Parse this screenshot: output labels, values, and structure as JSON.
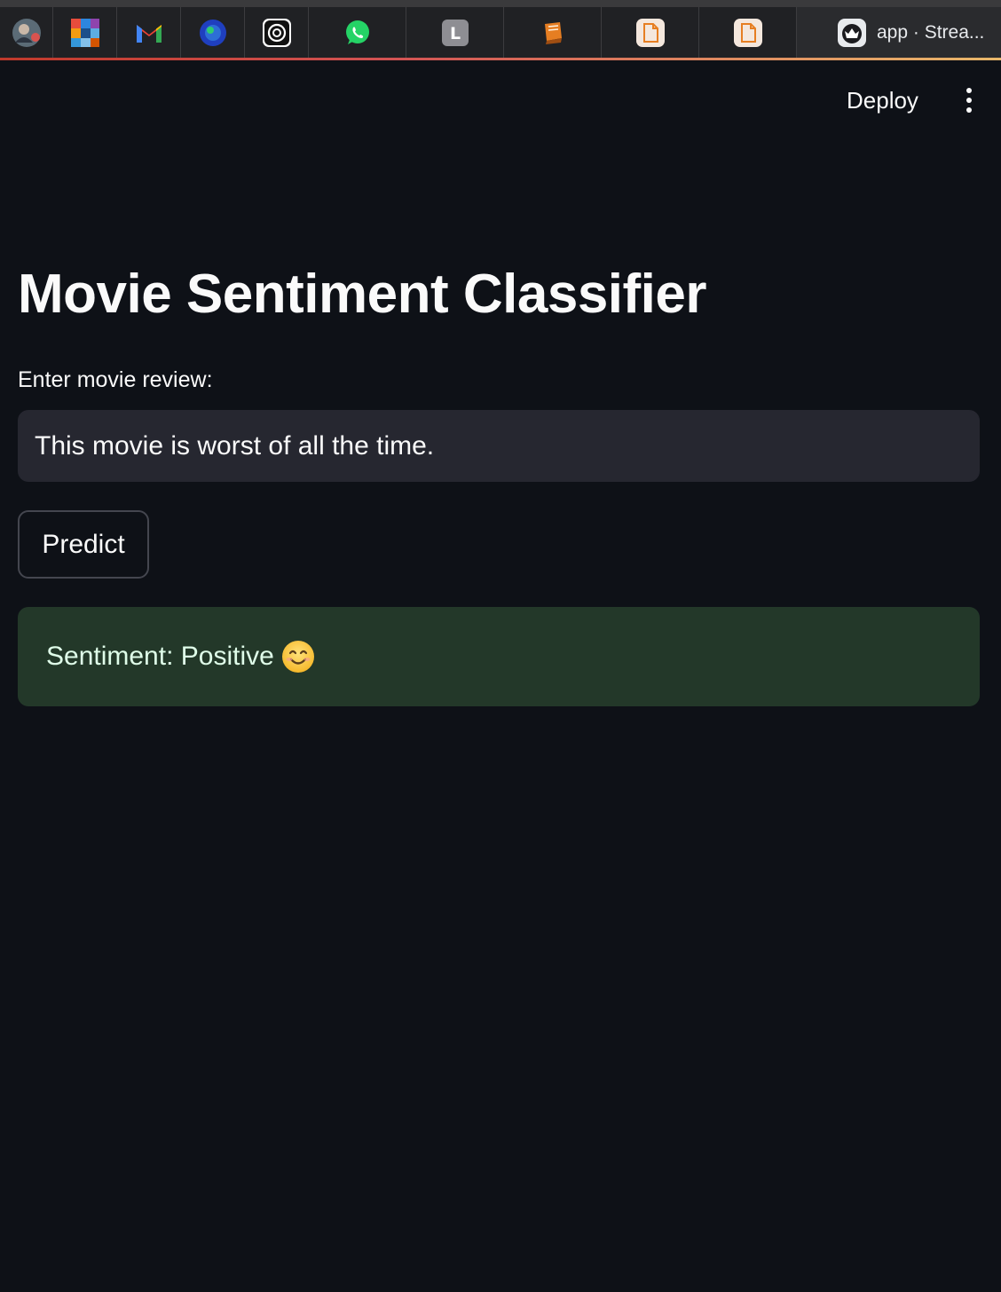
{
  "browser": {
    "active_tab": {
      "title": "app · Strea..."
    },
    "pinned_tabs": [
      {
        "icon": "profile-avatar-icon"
      },
      {
        "icon": "colorful-grid-icon"
      },
      {
        "icon": "gmail-icon"
      },
      {
        "icon": "blue-orb-icon"
      },
      {
        "icon": "chatgpt-icon"
      },
      {
        "icon": "whatsapp-icon"
      },
      {
        "icon": "letter-l-icon",
        "letter": "L"
      },
      {
        "icon": "orange-book-icon"
      },
      {
        "icon": "document-icon"
      },
      {
        "icon": "document-icon"
      }
    ]
  },
  "header": {
    "deploy_label": "Deploy",
    "menu_icon": "kebab-menu-icon"
  },
  "main": {
    "title": "Movie Sentiment Classifier",
    "review_label": "Enter movie review:",
    "review_value": "This movie is worst of all the time.",
    "predict_label": "Predict",
    "result_text": "Sentiment: Positive",
    "result_icon": "smiling-face-emoji"
  },
  "colors": {
    "background": "#0e1117",
    "input_bg": "#262730",
    "success_bg": "#233829",
    "success_text": "#dffde9"
  }
}
